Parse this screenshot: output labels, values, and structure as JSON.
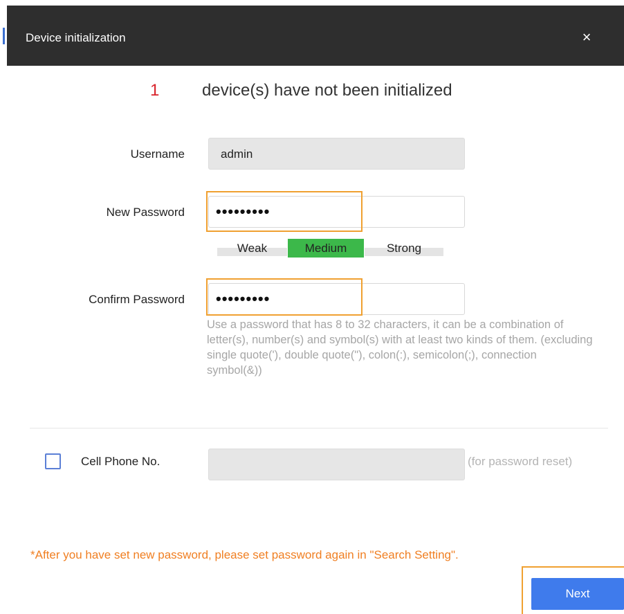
{
  "dialog": {
    "title": "Device initialization",
    "close_symbol": "×"
  },
  "header": {
    "count": "1",
    "text": "device(s) have not been initialized"
  },
  "form": {
    "username_label": "Username",
    "username_value": "admin",
    "new_password_label": "New Password",
    "new_password_mask": "•••••••••",
    "strength": {
      "weak": "Weak",
      "medium": "Medium",
      "strong": "Strong",
      "selected": "Medium"
    },
    "confirm_password_label": "Confirm Password",
    "confirm_password_mask": "•••••••••",
    "hint": "Use a password that has 8 to 32 characters, it can be a combination of letter(s), number(s) and symbol(s) with at least two kinds of them. (excluding single quote('), double quote(\"), colon(:), semicolon(;), connection symbol(&))",
    "cell_phone_label": "Cell Phone No.",
    "cell_phone_value": "",
    "cell_phone_hint": "(for password reset)",
    "cell_phone_checked": false
  },
  "footer": {
    "note": "*After you have set new password, please set password again in \"Search Setting\".",
    "next_label": "Next"
  },
  "colors": {
    "titlebar": "#2e2e2e",
    "count": "#d9232b",
    "highlight": "#f0a030",
    "strength_active": "#3cb84a",
    "note": "#f07f22",
    "primary_button": "#3f7bec"
  }
}
